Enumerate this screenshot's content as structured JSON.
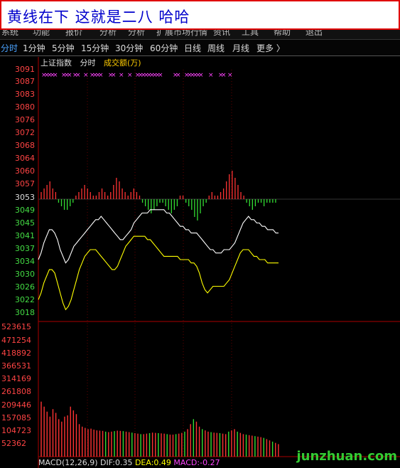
{
  "title": "黄线在下  这就是二八  哈哈",
  "menu_items": [
    "系统",
    "功能",
    "报价",
    "分析",
    "分析",
    "扩展市场行情",
    "资讯",
    "工具",
    "帮助",
    "退出"
  ],
  "periods": [
    {
      "label": "分时",
      "active": true
    },
    {
      "label": "1分钟",
      "active": false
    },
    {
      "label": "5分钟",
      "active": false
    },
    {
      "label": "15分钟",
      "active": false
    },
    {
      "label": "30分钟",
      "active": false
    },
    {
      "label": "60分钟",
      "active": false
    },
    {
      "label": "日线",
      "active": false
    },
    {
      "label": "周线",
      "active": false
    },
    {
      "label": "月线",
      "active": false
    },
    {
      "label": "更多 〉",
      "active": false
    }
  ],
  "info": {
    "index_name": "上证指数",
    "mode": "分时",
    "volume_label": "成交额(万)"
  },
  "price_axis": {
    "base": "3053",
    "up_labels": [
      "3091",
      "3087",
      "3083",
      "3080",
      "3076",
      "3072",
      "3068",
      "3064",
      "3060",
      "3057"
    ],
    "down_labels": [
      "3049",
      "3045",
      "3041",
      "3037",
      "3034",
      "3030",
      "3026",
      "3022",
      "3018"
    ]
  },
  "volume_axis": [
    "523615",
    "471254",
    "418892",
    "366531",
    "314169",
    "261808",
    "209446",
    "157085",
    "104723",
    "52362"
  ],
  "macd": {
    "params": "MACD(12,26,9)",
    "dif_label": "DIF:",
    "dif_value": "0.35",
    "dea_label": "DEA:",
    "dea_value": "0.49",
    "macd_label": "MACD:",
    "macd_value": "-0.27"
  },
  "watermark": "junzhuan.com",
  "colors": {
    "up": "#ff4444",
    "down": "#44dd44",
    "white_line": "#ffffff",
    "yellow_line": "#ffff00",
    "magenta": "#ff44ff",
    "active_tab": "#4aa3ff"
  },
  "chart_data": {
    "type": "line",
    "y_range": [
      3018,
      3091
    ],
    "baseline": 3053,
    "series": [
      {
        "name": "",
        "color": "white",
        "values": [
          3034,
          3036,
          3039,
          3041,
          3043,
          3043,
          3042,
          3040,
          3037,
          3035,
          3033,
          3034,
          3036,
          3038,
          3039,
          3040,
          3041,
          3042,
          3043,
          3044,
          3045,
          3046,
          3046,
          3047,
          3046,
          3045,
          3044,
          3043,
          3042,
          3041,
          3040,
          3040,
          3041,
          3042,
          3043,
          3045,
          3046,
          3047,
          3048,
          3048,
          3048,
          3049,
          3049,
          3049,
          3049,
          3049,
          3049,
          3048,
          3048,
          3047,
          3046,
          3045,
          3044,
          3044,
          3043,
          3043,
          3042,
          3042,
          3042,
          3041,
          3040,
          3039,
          3038,
          3037,
          3037,
          3036,
          3036,
          3036,
          3037,
          3037,
          3037,
          3038,
          3039,
          3041,
          3043,
          3045,
          3046,
          3047,
          3046,
          3046,
          3045,
          3045,
          3044,
          3044,
          3043,
          3043,
          3043,
          3042,
          3042
        ]
      },
      {
        "name": "",
        "color": "yellow",
        "values": [
          3022,
          3024,
          3027,
          3029,
          3031,
          3031,
          3030,
          3027,
          3024,
          3021,
          3019,
          3020,
          3022,
          3025,
          3028,
          3031,
          3033,
          3035,
          3036,
          3037,
          3037,
          3037,
          3036,
          3035,
          3034,
          3033,
          3032,
          3031,
          3031,
          3032,
          3034,
          3036,
          3038,
          3039,
          3040,
          3041,
          3041,
          3041,
          3041,
          3041,
          3040,
          3040,
          3039,
          3038,
          3037,
          3036,
          3035,
          3035,
          3035,
          3035,
          3035,
          3035,
          3034,
          3034,
          3034,
          3034,
          3033,
          3033,
          3032,
          3030,
          3027,
          3025,
          3024,
          3025,
          3026,
          3026,
          3026,
          3026,
          3026,
          3027,
          3028,
          3030,
          3032,
          3034,
          3036,
          3037,
          3037,
          3037,
          3036,
          3035,
          3035,
          3034,
          3034,
          3034,
          3033,
          3033,
          3033,
          3033,
          3033
        ]
      }
    ],
    "macd_bars": [
      2,
      3,
      4,
      5,
      3,
      2,
      -1,
      -2,
      -3,
      -3,
      -2,
      -1,
      1,
      2,
      3,
      4,
      3,
      2,
      1,
      1,
      2,
      3,
      2,
      1,
      2,
      4,
      6,
      5,
      3,
      2,
      1,
      2,
      3,
      2,
      1,
      -1,
      -2,
      -3,
      -4,
      -3,
      -2,
      -1,
      -1,
      -2,
      -3,
      -4,
      -3,
      -2,
      1,
      1,
      -1,
      -2,
      -3,
      -5,
      -6,
      -4,
      -2,
      -1,
      1,
      2,
      1,
      1,
      2,
      3,
      5,
      7,
      8,
      6,
      4,
      2,
      1,
      -1,
      -2,
      -3,
      -2,
      -1,
      -1,
      -2,
      -1,
      -1,
      -1,
      -1
    ],
    "volume_bars": [
      220000,
      200000,
      180000,
      160000,
      190000,
      175000,
      150000,
      140000,
      160000,
      165000,
      200000,
      185000,
      170000,
      130000,
      120000,
      115000,
      110000,
      112000,
      108000,
      105000,
      104000,
      103000,
      100000,
      98000,
      100000,
      102000,
      104000,
      103000,
      102000,
      100000,
      98000,
      96000,
      94000,
      92000,
      90000,
      90000,
      92000,
      94000,
      96000,
      95000,
      94000,
      93000,
      92000,
      90000,
      88000,
      88000,
      90000,
      92000,
      95000,
      100000,
      110000,
      130000,
      150000,
      140000,
      120000,
      110000,
      105000,
      100000,
      98000,
      96000,
      95000,
      94000,
      92000,
      90000,
      100000,
      105000,
      110000,
      100000,
      95000,
      90000,
      88000,
      86000,
      84000,
      82000,
      80000,
      78000,
      75000,
      70000,
      65000,
      60000,
      55000,
      50000
    ]
  }
}
